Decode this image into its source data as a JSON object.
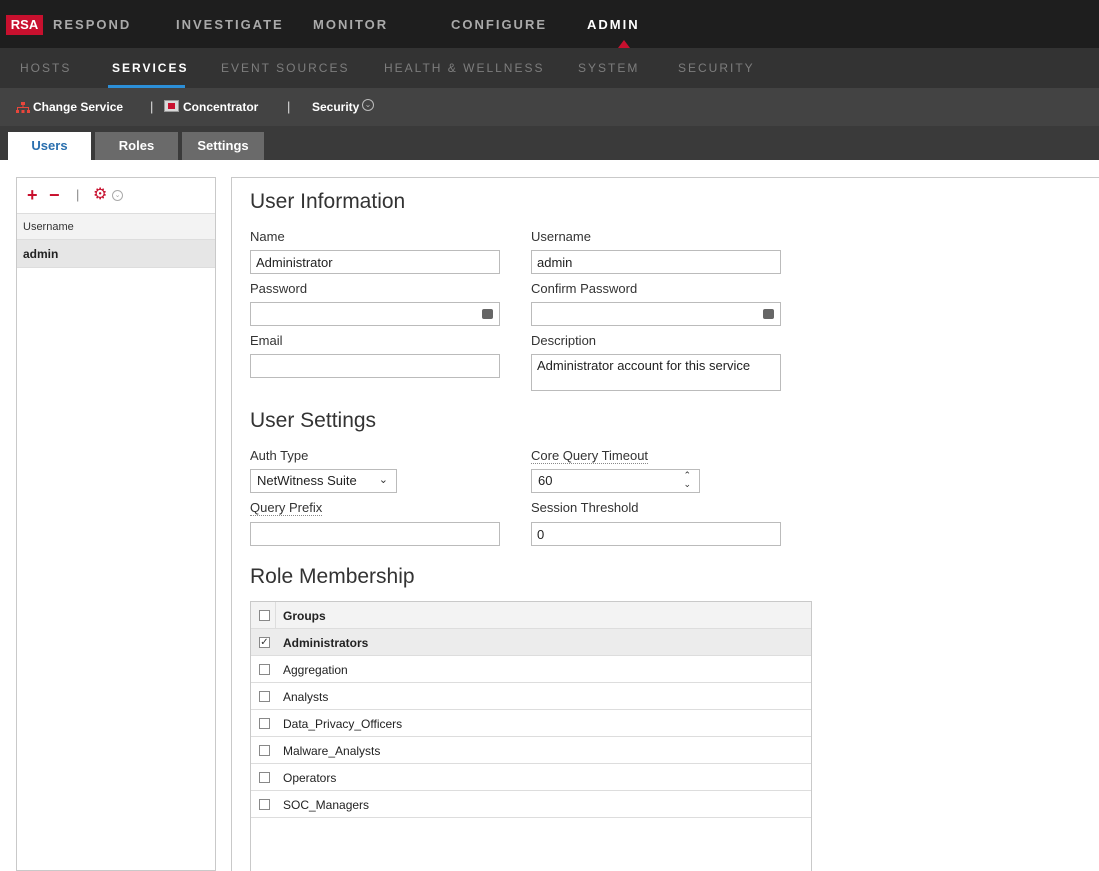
{
  "brand": {
    "logo_text": "RSA"
  },
  "top_nav": [
    "RESPOND",
    "INVESTIGATE",
    "MONITOR",
    "CONFIGURE",
    "ADMIN"
  ],
  "sub_nav": [
    "HOSTS",
    "SERVICES",
    "EVENT SOURCES",
    "HEALTH & WELLNESS",
    "SYSTEM",
    "SECURITY"
  ],
  "service_bar": {
    "change_service": "Change Service",
    "service_name": "Concentrator",
    "view": "Security"
  },
  "tabs": [
    "Users",
    "Roles",
    "Settings"
  ],
  "left_panel": {
    "column_header": "Username",
    "users": [
      "admin"
    ]
  },
  "user_information": {
    "heading": "User Information",
    "name_label": "Name",
    "name_value": "Administrator",
    "username_label": "Username",
    "username_value": "admin",
    "password_label": "Password",
    "confirm_password_label": "Confirm Password",
    "email_label": "Email",
    "email_value": "",
    "description_label": "Description",
    "description_value": "Administrator account for this service"
  },
  "user_settings": {
    "heading": "User Settings",
    "auth_type_label": "Auth Type",
    "auth_type_value": "NetWitness Suite",
    "core_query_timeout_label": "Core Query Timeout",
    "core_query_timeout_value": "60",
    "query_prefix_label": "Query Prefix",
    "query_prefix_value": "",
    "session_threshold_label": "Session Threshold",
    "session_threshold_value": "0"
  },
  "role_membership": {
    "heading": "Role Membership",
    "column_header": "Groups",
    "groups": [
      {
        "name": "Administrators",
        "checked": true
      },
      {
        "name": "Aggregation",
        "checked": false
      },
      {
        "name": "Analysts",
        "checked": false
      },
      {
        "name": "Data_Privacy_Officers",
        "checked": false
      },
      {
        "name": "Malware_Analysts",
        "checked": false
      },
      {
        "name": "Operators",
        "checked": false
      },
      {
        "name": "SOC_Managers",
        "checked": false
      }
    ]
  },
  "colors": {
    "brand_red": "#c8102e",
    "accent_blue": "#2c8fd8",
    "tab_active_text": "#2a6fae"
  }
}
